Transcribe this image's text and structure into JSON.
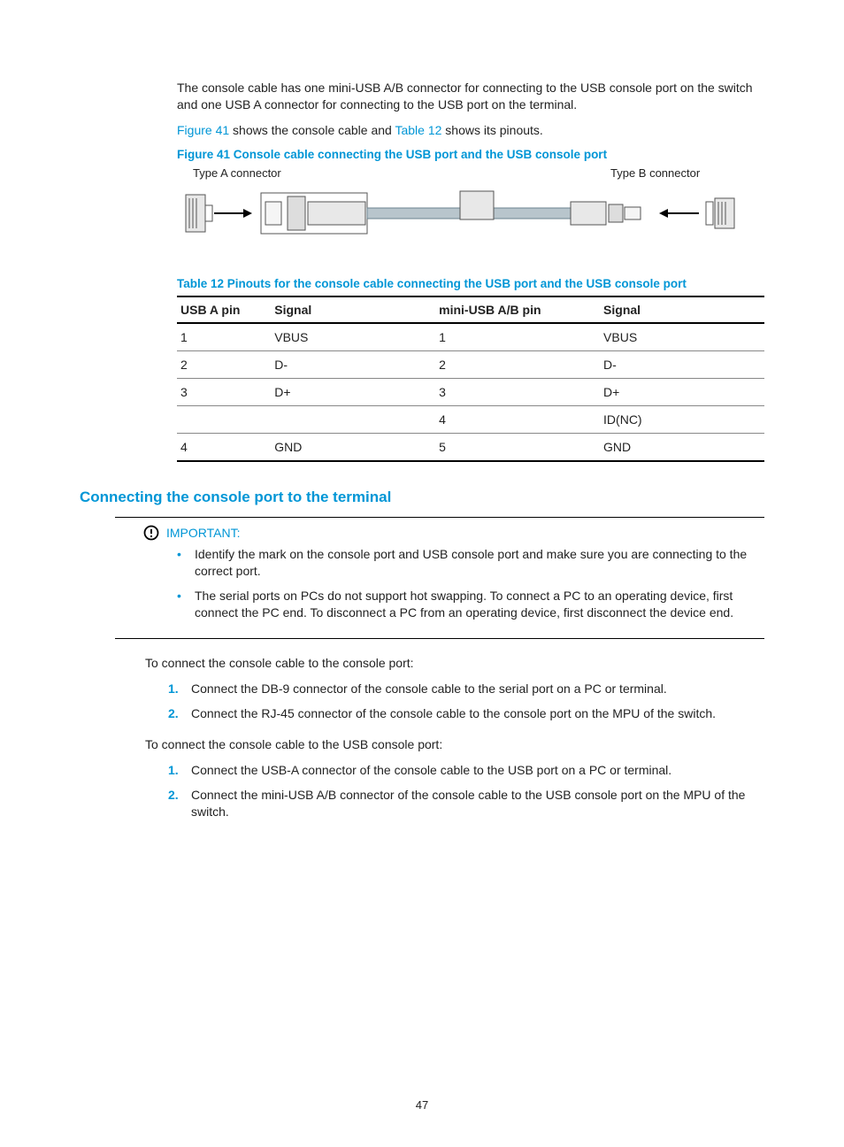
{
  "intro": {
    "p1": "The console cable has one mini-USB A/B connector for connecting to the USB console port on the switch and one USB A connector for connecting to the USB port on the terminal.",
    "p2_pre": "",
    "link_figure": "Figure 41",
    "p2_mid": " shows the console cable and ",
    "link_table": "Table 12",
    "p2_post": " shows its pinouts."
  },
  "figure": {
    "caption": "Figure 41 Console cable connecting the USB port and the USB console port",
    "label_a": "Type A connector",
    "label_b": "Type B connector"
  },
  "table": {
    "caption": "Table 12 Pinouts for the console cable connecting the USB port and the USB console port",
    "headers": [
      "USB A pin",
      "Signal",
      "mini-USB A/B pin",
      "Signal"
    ],
    "rows": [
      [
        "1",
        "VBUS",
        "1",
        "VBUS"
      ],
      [
        "2",
        "D-",
        "2",
        "D-"
      ],
      [
        "3",
        "D+",
        "3",
        "D+"
      ],
      [
        "",
        "",
        "4",
        "ID(NC)"
      ],
      [
        "4",
        "GND",
        "5",
        "GND"
      ]
    ]
  },
  "section_heading": "Connecting the console port to the terminal",
  "callout": {
    "label": "IMPORTANT:",
    "items": [
      "Identify the mark on the console port and USB console port and make sure you are connecting to the correct port.",
      "The serial ports on PCs do not support hot swapping. To connect a PC to an operating device, first connect the PC end. To disconnect a PC from an operating device, first disconnect the device end."
    ]
  },
  "instr1_lead": "To connect the console cable to the console port:",
  "instr1": [
    "Connect the DB-9 connector of the console cable to the serial port on a PC or terminal.",
    "Connect the RJ-45 connector of the console cable to the console port on the MPU of the switch."
  ],
  "instr2_lead": "To connect the console cable to the USB console port:",
  "instr2": [
    "Connect the USB-A connector of the console cable to the USB port on a PC or terminal.",
    "Connect the mini-USB A/B connector of the console cable to the USB console port on the MPU of the switch."
  ],
  "page_number": "47"
}
